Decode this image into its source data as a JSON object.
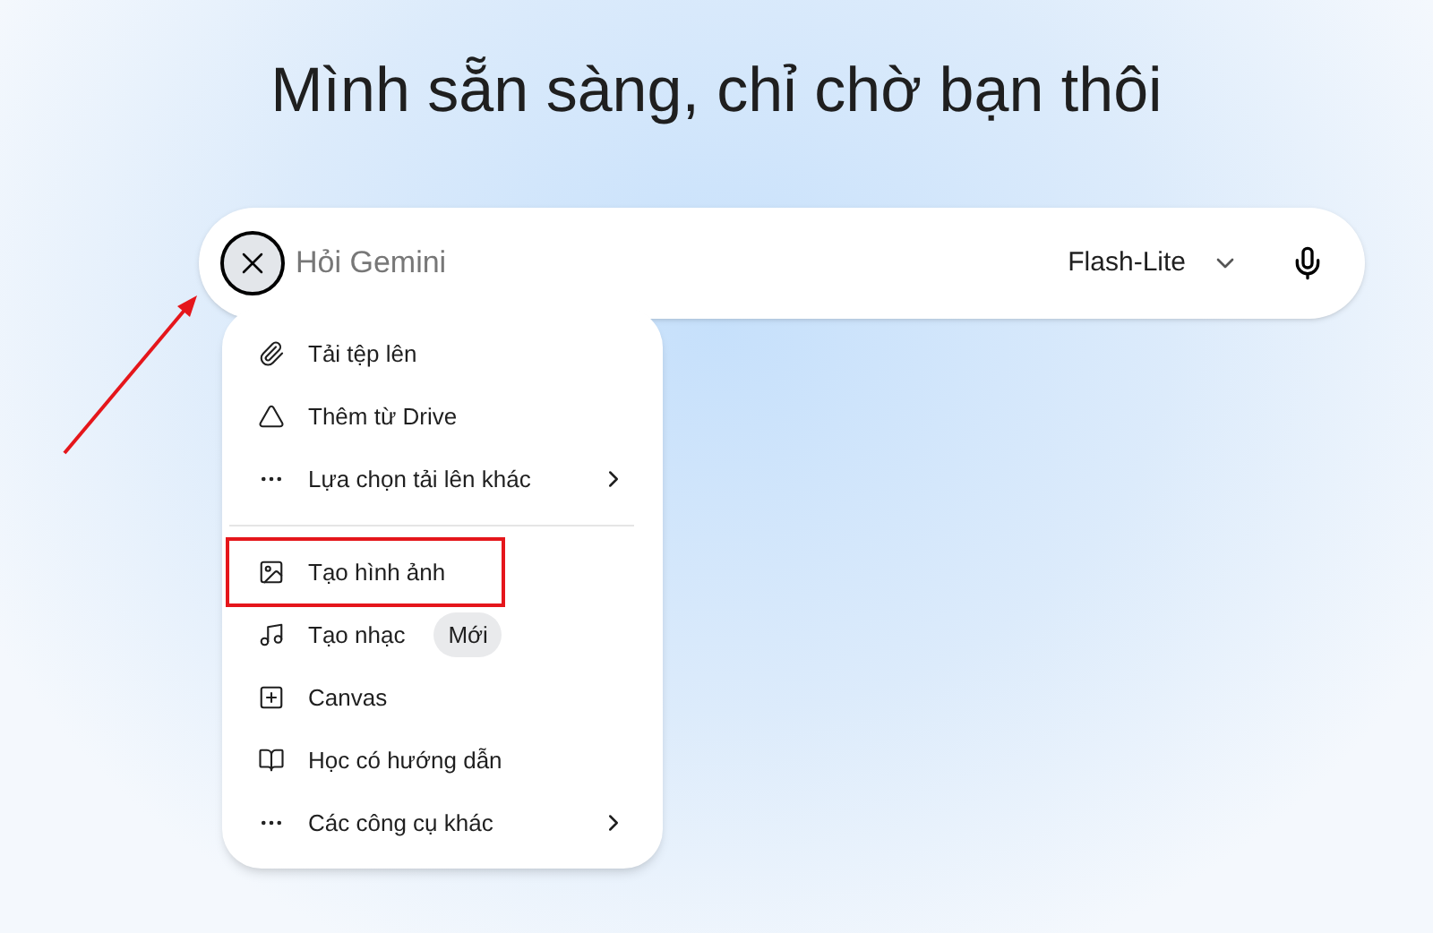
{
  "heading": "Mình sẵn sàng, chỉ chờ bạn thôi",
  "prompt": {
    "placeholder": "Hỏi Gemini",
    "model": "Flash-Lite",
    "menu_open": true
  },
  "menu": {
    "sections": [
      {
        "items": [
          {
            "label": "Tải tệp lên",
            "has_submenu": false,
            "highlighted": false
          },
          {
            "label": "Thêm từ Drive",
            "has_submenu": false,
            "highlighted": false
          },
          {
            "label": "Lựa chọn tải lên khác",
            "has_submenu": true,
            "highlighted": false
          }
        ]
      },
      {
        "items": [
          {
            "label": "Tạo hình ảnh",
            "has_submenu": false,
            "highlighted": true
          },
          {
            "label": "Tạo nhạc",
            "badge": "Mới",
            "has_submenu": false,
            "highlighted": false
          },
          {
            "label": "Canvas",
            "has_submenu": false,
            "highlighted": false
          },
          {
            "label": "Học có hướng dẫn",
            "has_submenu": false,
            "highlighted": false
          },
          {
            "label": "Các công cụ khác",
            "has_submenu": true,
            "highlighted": false
          }
        ]
      }
    ]
  },
  "annotation_arrow": true
}
